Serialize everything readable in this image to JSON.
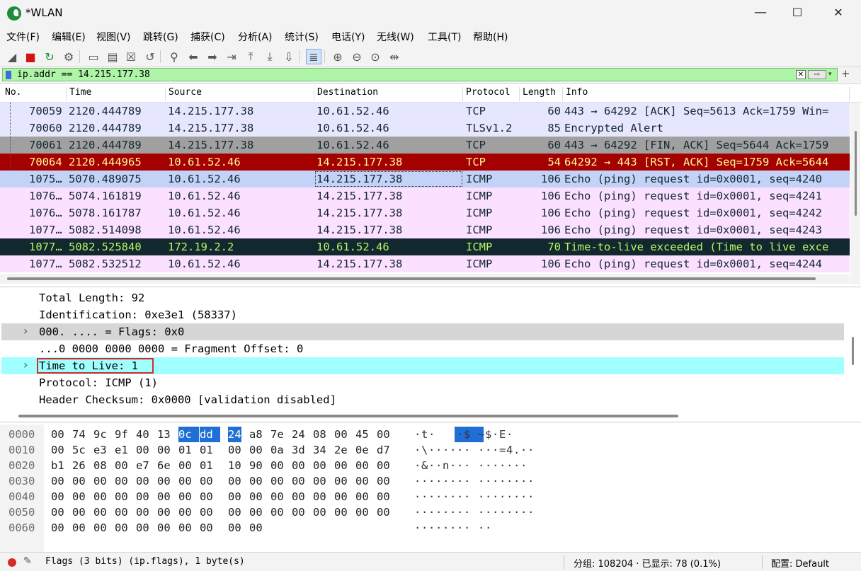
{
  "window": {
    "title": "*WLAN",
    "minimize": "—",
    "maximize": "☐",
    "close": "✕"
  },
  "menu": [
    "文件(F)",
    "编辑(E)",
    "视图(V)",
    "跳转(G)",
    "捕获(C)",
    "分析(A)",
    "统计(S)",
    "电话(Y)",
    "无线(W)",
    "工具(T)",
    "帮助(H)"
  ],
  "toolbar": [
    {
      "name": "start-capture-icon",
      "glyph": "◢"
    },
    {
      "name": "stop-capture-icon",
      "glyph": "■"
    },
    {
      "name": "restart-capture-icon",
      "glyph": "↻"
    },
    {
      "name": "capture-options-icon",
      "glyph": "⚙"
    },
    {
      "name": "open-file-icon",
      "glyph": "▭"
    },
    {
      "name": "save-file-icon",
      "glyph": "▤"
    },
    {
      "name": "close-file-icon",
      "glyph": "☒"
    },
    {
      "name": "reload-file-icon",
      "glyph": "↺"
    },
    {
      "name": "find-packet-icon",
      "glyph": "⚲"
    },
    {
      "name": "go-back-icon",
      "glyph": "⬅"
    },
    {
      "name": "go-forward-icon",
      "glyph": "➡"
    },
    {
      "name": "go-to-packet-icon",
      "glyph": "⇥"
    },
    {
      "name": "first-packet-icon",
      "glyph": "⤒"
    },
    {
      "name": "last-packet-icon",
      "glyph": "⤓"
    },
    {
      "name": "autoscroll-icon",
      "glyph": "⇩"
    },
    {
      "name": "colorize-icon",
      "glyph": "≣"
    },
    {
      "name": "zoom-in-icon",
      "glyph": "⊕"
    },
    {
      "name": "zoom-out-icon",
      "glyph": "⊖"
    },
    {
      "name": "zoom-normal-icon",
      "glyph": "⊙"
    },
    {
      "name": "resize-columns-icon",
      "glyph": "⇹"
    }
  ],
  "filter": {
    "value": "ip.addr == 14.215.177.38",
    "clear": "✕",
    "apply": "⇨",
    "dropdown": "▾",
    "add": "+"
  },
  "columns": [
    "No.",
    "Time",
    "Source",
    "Destination",
    "Protocol",
    "Length",
    "Info"
  ],
  "packets": [
    {
      "no": "70059",
      "time": "2120.444789",
      "src": "14.215.177.38",
      "dst": "10.61.52.46",
      "proto": "TCP",
      "len": "60",
      "info": "443 → 64292 [ACK] Seq=5613 Ack=1759 Win=",
      "bg": "#e7e6ff",
      "fg": "#12272e"
    },
    {
      "no": "70060",
      "time": "2120.444789",
      "src": "14.215.177.38",
      "dst": "10.61.52.46",
      "proto": "TLSv1.2",
      "len": "85",
      "info": "Encrypted Alert",
      "bg": "#e7e6ff",
      "fg": "#12272e"
    },
    {
      "no": "70061",
      "time": "2120.444789",
      "src": "14.215.177.38",
      "dst": "10.61.52.46",
      "proto": "TCP",
      "len": "60",
      "info": "443 → 64292 [FIN, ACK] Seq=5644 Ack=1759",
      "bg": "#a0a0a0",
      "fg": "#12272e"
    },
    {
      "no": "70064",
      "time": "2120.444965",
      "src": "10.61.52.46",
      "dst": "14.215.177.38",
      "proto": "TCP",
      "len": "54",
      "info": "64292 → 443 [RST, ACK] Seq=1759 Ack=5644",
      "bg": "#a40000",
      "fg": "#fffc9c"
    },
    {
      "no": "1075…",
      "time": "5070.489075",
      "src": "10.61.52.46",
      "dst": "14.215.177.38",
      "proto": "ICMP",
      "len": "106",
      "info": "Echo (ping) request  id=0x0001, seq=4240",
      "bg": "#c5d2f7",
      "fg": "#12272e"
    },
    {
      "no": "1076…",
      "time": "5074.161819",
      "src": "10.61.52.46",
      "dst": "14.215.177.38",
      "proto": "ICMP",
      "len": "106",
      "info": "Echo (ping) request  id=0x0001, seq=4241",
      "bg": "#fce0ff",
      "fg": "#12272e"
    },
    {
      "no": "1076…",
      "time": "5078.161787",
      "src": "10.61.52.46",
      "dst": "14.215.177.38",
      "proto": "ICMP",
      "len": "106",
      "info": "Echo (ping) request  id=0x0001, seq=4242",
      "bg": "#fce0ff",
      "fg": "#12272e"
    },
    {
      "no": "1077…",
      "time": "5082.514098",
      "src": "10.61.52.46",
      "dst": "14.215.177.38",
      "proto": "ICMP",
      "len": "106",
      "info": "Echo (ping) request  id=0x0001, seq=4243",
      "bg": "#fce0ff",
      "fg": "#12272e"
    },
    {
      "no": "1077…",
      "time": "5082.525840",
      "src": "172.19.2.2",
      "dst": "10.61.52.46",
      "proto": "ICMP",
      "len": "70",
      "info": "Time-to-live exceeded (Time to live exce",
      "bg": "#12272e",
      "fg": "#b5f766"
    },
    {
      "no": "1077…",
      "time": "5082.532512",
      "src": "10.61.52.46",
      "dst": "14.215.177.38",
      "proto": "ICMP",
      "len": "106",
      "info": "Echo (ping) request  id=0x0001, seq=4244",
      "bg": "#fce0ff",
      "fg": "#12272e"
    }
  ],
  "details": [
    {
      "text": "Total Length: 92",
      "expandable": false,
      "bg": "#ffffff"
    },
    {
      "text": "Identification: 0xe3e1 (58337)",
      "expandable": false,
      "bg": "#ffffff"
    },
    {
      "text": "000. .... = Flags: 0x0",
      "expandable": true,
      "bg": "#d6d6d6"
    },
    {
      "text": "...0 0000 0000 0000 = Fragment Offset: 0",
      "expandable": false,
      "bg": "#ffffff"
    },
    {
      "text": "Time to Live: 1",
      "expandable": true,
      "bg": "#a0ffff",
      "boxed": true
    },
    {
      "text": "Protocol: ICMP (1)",
      "expandable": false,
      "bg": "#ffffff"
    },
    {
      "text": "Header Checksum: 0x0000 [validation disabled]",
      "expandable": false,
      "bg": "#ffffff"
    }
  ],
  "bytes": [
    {
      "offset": "0000",
      "hex": [
        "00",
        "74",
        "9c",
        "9f",
        "40",
        "13",
        "0c",
        "dd",
        "24",
        "a8",
        "7e",
        "24",
        "08",
        "00",
        "45",
        "00"
      ],
      "ascii": [
        "·",
        "t",
        "·",
        "@",
        "·",
        "·",
        "·",
        "$",
        "~",
        "$",
        "·",
        "E",
        "·"
      ],
      "hex_hl": [
        6,
        7,
        8
      ],
      "ascii_hl": [
        3,
        4,
        5
      ]
    },
    {
      "offset": "0010",
      "hex": [
        "00",
        "5c",
        "e3",
        "e1",
        "00",
        "00",
        "01",
        "01",
        "00",
        "00",
        "0a",
        "3d",
        "34",
        "2e",
        "0e",
        "d7"
      ],
      "ascii": [
        "·",
        "\\",
        "·",
        "·",
        "·",
        "·",
        "·",
        "·",
        "·",
        "·",
        "·",
        "=",
        "4",
        ".",
        "·",
        "·"
      ],
      "hex_hl": [],
      "ascii_hl": []
    },
    {
      "offset": "0020",
      "hex": [
        "b1",
        "26",
        "08",
        "00",
        "e7",
        "6e",
        "00",
        "01",
        "10",
        "90",
        "00",
        "00",
        "00",
        "00",
        "00",
        "00"
      ],
      "ascii": [
        "·",
        "&",
        "·",
        "·",
        "n",
        "·",
        "·",
        "·",
        "·",
        "·",
        "·",
        "·",
        "·",
        "·",
        "·"
      ],
      "hex_hl": [],
      "ascii_hl": []
    },
    {
      "offset": "0030",
      "hex": [
        "00",
        "00",
        "00",
        "00",
        "00",
        "00",
        "00",
        "00",
        "00",
        "00",
        "00",
        "00",
        "00",
        "00",
        "00",
        "00"
      ],
      "ascii": [
        "·",
        "·",
        "·",
        "·",
        "·",
        "·",
        "·",
        "·",
        "·",
        "·",
        "·",
        "·",
        "·",
        "·",
        "·",
        "·"
      ],
      "hex_hl": [],
      "ascii_hl": []
    },
    {
      "offset": "0040",
      "hex": [
        "00",
        "00",
        "00",
        "00",
        "00",
        "00",
        "00",
        "00",
        "00",
        "00",
        "00",
        "00",
        "00",
        "00",
        "00",
        "00"
      ],
      "ascii": [
        "·",
        "·",
        "·",
        "·",
        "·",
        "·",
        "·",
        "·",
        "·",
        "·",
        "·",
        "·",
        "·",
        "·",
        "·",
        "·"
      ],
      "hex_hl": [],
      "ascii_hl": []
    },
    {
      "offset": "0050",
      "hex": [
        "00",
        "00",
        "00",
        "00",
        "00",
        "00",
        "00",
        "00",
        "00",
        "00",
        "00",
        "00",
        "00",
        "00",
        "00",
        "00"
      ],
      "ascii": [
        "·",
        "·",
        "·",
        "·",
        "·",
        "·",
        "·",
        "·",
        "·",
        "·",
        "·",
        "·",
        "·",
        "·",
        "·",
        "·"
      ],
      "hex_hl": [],
      "ascii_hl": []
    },
    {
      "offset": "0060",
      "hex": [
        "00",
        "00",
        "00",
        "00",
        "00",
        "00",
        "00",
        "00",
        "00",
        "00"
      ],
      "ascii": [
        "·",
        "·",
        "·",
        "·",
        "·",
        "·",
        "·",
        "·",
        "·",
        "·"
      ],
      "hex_hl": [],
      "ascii_hl": []
    }
  ],
  "status": {
    "field": "Flags (3 bits) (ip.flags), 1 byte(s)",
    "packets": "分组: 108204 · 已显示: 78 (0.1%)",
    "profile": "配置: Default"
  },
  "colors": {
    "selected_box": "#d42a2a",
    "byte_highlight": "#1f6fd6"
  }
}
